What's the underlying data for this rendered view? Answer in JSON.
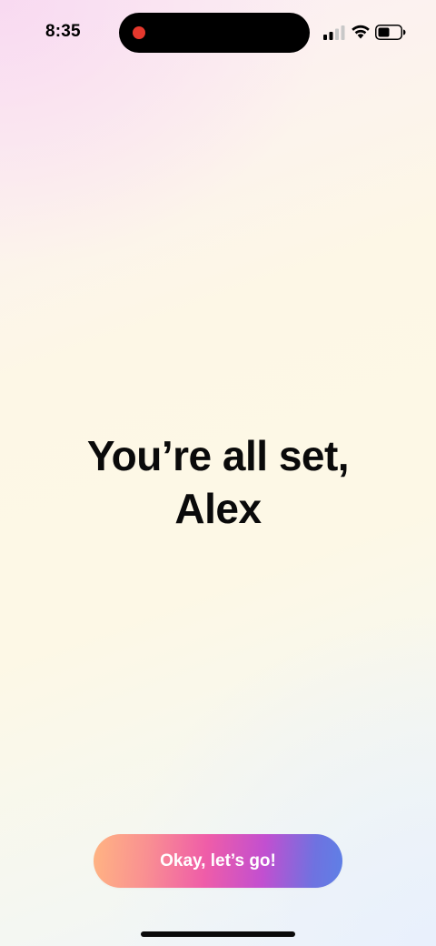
{
  "status_bar": {
    "time": "8:35",
    "recording_indicator_color": "#e5382d",
    "signal_icon": "cellular-signal-icon",
    "wifi_icon": "wifi-icon",
    "battery_icon": "battery-icon",
    "battery_level": 0.5
  },
  "main": {
    "headline_line1": "You’re all set,",
    "headline_line2": "Alex"
  },
  "cta": {
    "label": "Okay, let’s go!",
    "gradient_colors": [
      "#ffb482",
      "#ef5da8",
      "#c24fd0",
      "#5e80e6"
    ]
  }
}
